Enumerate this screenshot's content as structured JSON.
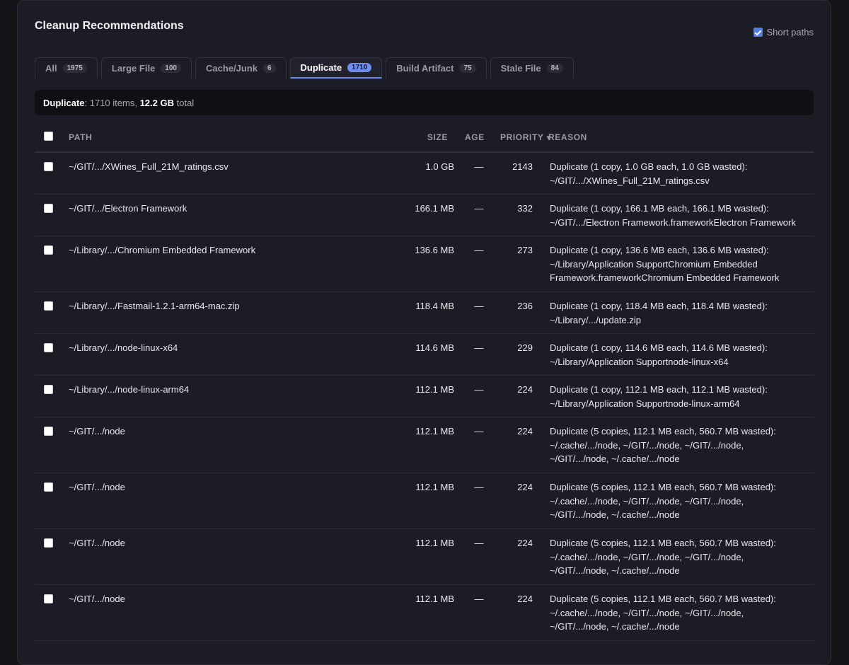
{
  "header": {
    "title": "Cleanup Recommendations",
    "short_paths_label": "Short paths",
    "short_paths_checked": true
  },
  "tabs": [
    {
      "label": "All",
      "count": "1975",
      "active": false
    },
    {
      "label": "Large File",
      "count": "100",
      "active": false
    },
    {
      "label": "Cache/Junk",
      "count": "6",
      "active": false
    },
    {
      "label": "Duplicate",
      "count": "1710",
      "active": true
    },
    {
      "label": "Build Artifact",
      "count": "75",
      "active": false
    },
    {
      "label": "Stale File",
      "count": "84",
      "active": false
    }
  ],
  "summary": {
    "category": "Duplicate",
    "items_text": ": 1710 items, ",
    "size": "12.2 GB",
    "total_text": " total"
  },
  "table": {
    "columns": {
      "path": "PATH",
      "size": "SIZE",
      "age": "AGE",
      "priority": "PRIORITY",
      "sort_indicator": "▼",
      "reason": "REASON"
    },
    "rows": [
      {
        "path": "~/GIT/.../XWines_Full_21M_ratings.csv",
        "size": "1.0 GB",
        "age": "—",
        "priority": "2143",
        "reason": [
          "Duplicate (1 copy, 1.0 GB each, 1.0 GB wasted):",
          "~/GIT/.../XWines_Full_21M_ratings.csv"
        ]
      },
      {
        "path": "~/GIT/.../Electron Framework",
        "size": "166.1 MB",
        "age": "—",
        "priority": "332",
        "reason": [
          "Duplicate (1 copy, 166.1 MB each, 166.1 MB wasted):",
          "~/GIT/.../Electron Framework.frameworkElectron Framework"
        ]
      },
      {
        "path": "~/Library/.../Chromium Embedded Framework",
        "size": "136.6 MB",
        "age": "—",
        "priority": "273",
        "reason": [
          "Duplicate (1 copy, 136.6 MB each, 136.6 MB wasted):",
          "~/Library/Application SupportChromium Embedded",
          "Framework.frameworkChromium Embedded Framework"
        ]
      },
      {
        "path": "~/Library/.../Fastmail-1.2.1-arm64-mac.zip",
        "size": "118.4 MB",
        "age": "—",
        "priority": "236",
        "reason": [
          "Duplicate (1 copy, 118.4 MB each, 118.4 MB wasted):",
          "~/Library/.../update.zip"
        ]
      },
      {
        "path": "~/Library/.../node-linux-x64",
        "size": "114.6 MB",
        "age": "—",
        "priority": "229",
        "reason": [
          "Duplicate (1 copy, 114.6 MB each, 114.6 MB wasted):",
          "~/Library/Application Supportnode-linux-x64"
        ]
      },
      {
        "path": "~/Library/.../node-linux-arm64",
        "size": "112.1 MB",
        "age": "—",
        "priority": "224",
        "reason": [
          "Duplicate (1 copy, 112.1 MB each, 112.1 MB wasted):",
          "~/Library/Application Supportnode-linux-arm64"
        ]
      },
      {
        "path": "~/GIT/.../node",
        "size": "112.1 MB",
        "age": "—",
        "priority": "224",
        "reason": [
          "Duplicate (5 copies, 112.1 MB each, 560.7 MB wasted):",
          "~/.cache/.../node, ~/GIT/.../node, ~/GIT/.../node,",
          "~/GIT/.../node, ~/.cache/.../node"
        ]
      },
      {
        "path": "~/GIT/.../node",
        "size": "112.1 MB",
        "age": "—",
        "priority": "224",
        "reason": [
          "Duplicate (5 copies, 112.1 MB each, 560.7 MB wasted):",
          "~/.cache/.../node, ~/GIT/.../node, ~/GIT/.../node,",
          "~/GIT/.../node, ~/.cache/.../node"
        ]
      },
      {
        "path": "~/GIT/.../node",
        "size": "112.1 MB",
        "age": "—",
        "priority": "224",
        "reason": [
          "Duplicate (5 copies, 112.1 MB each, 560.7 MB wasted):",
          "~/.cache/.../node, ~/GIT/.../node, ~/GIT/.../node,",
          "~/GIT/.../node, ~/.cache/.../node"
        ]
      },
      {
        "path": "~/GIT/.../node",
        "size": "112.1 MB",
        "age": "—",
        "priority": "224",
        "reason": [
          "Duplicate (5 copies, 112.1 MB each, 560.7 MB wasted):",
          "~/.cache/.../node, ~/GIT/.../node, ~/GIT/.../node,",
          "~/GIT/.../node, ~/.cache/.../node"
        ]
      }
    ]
  }
}
